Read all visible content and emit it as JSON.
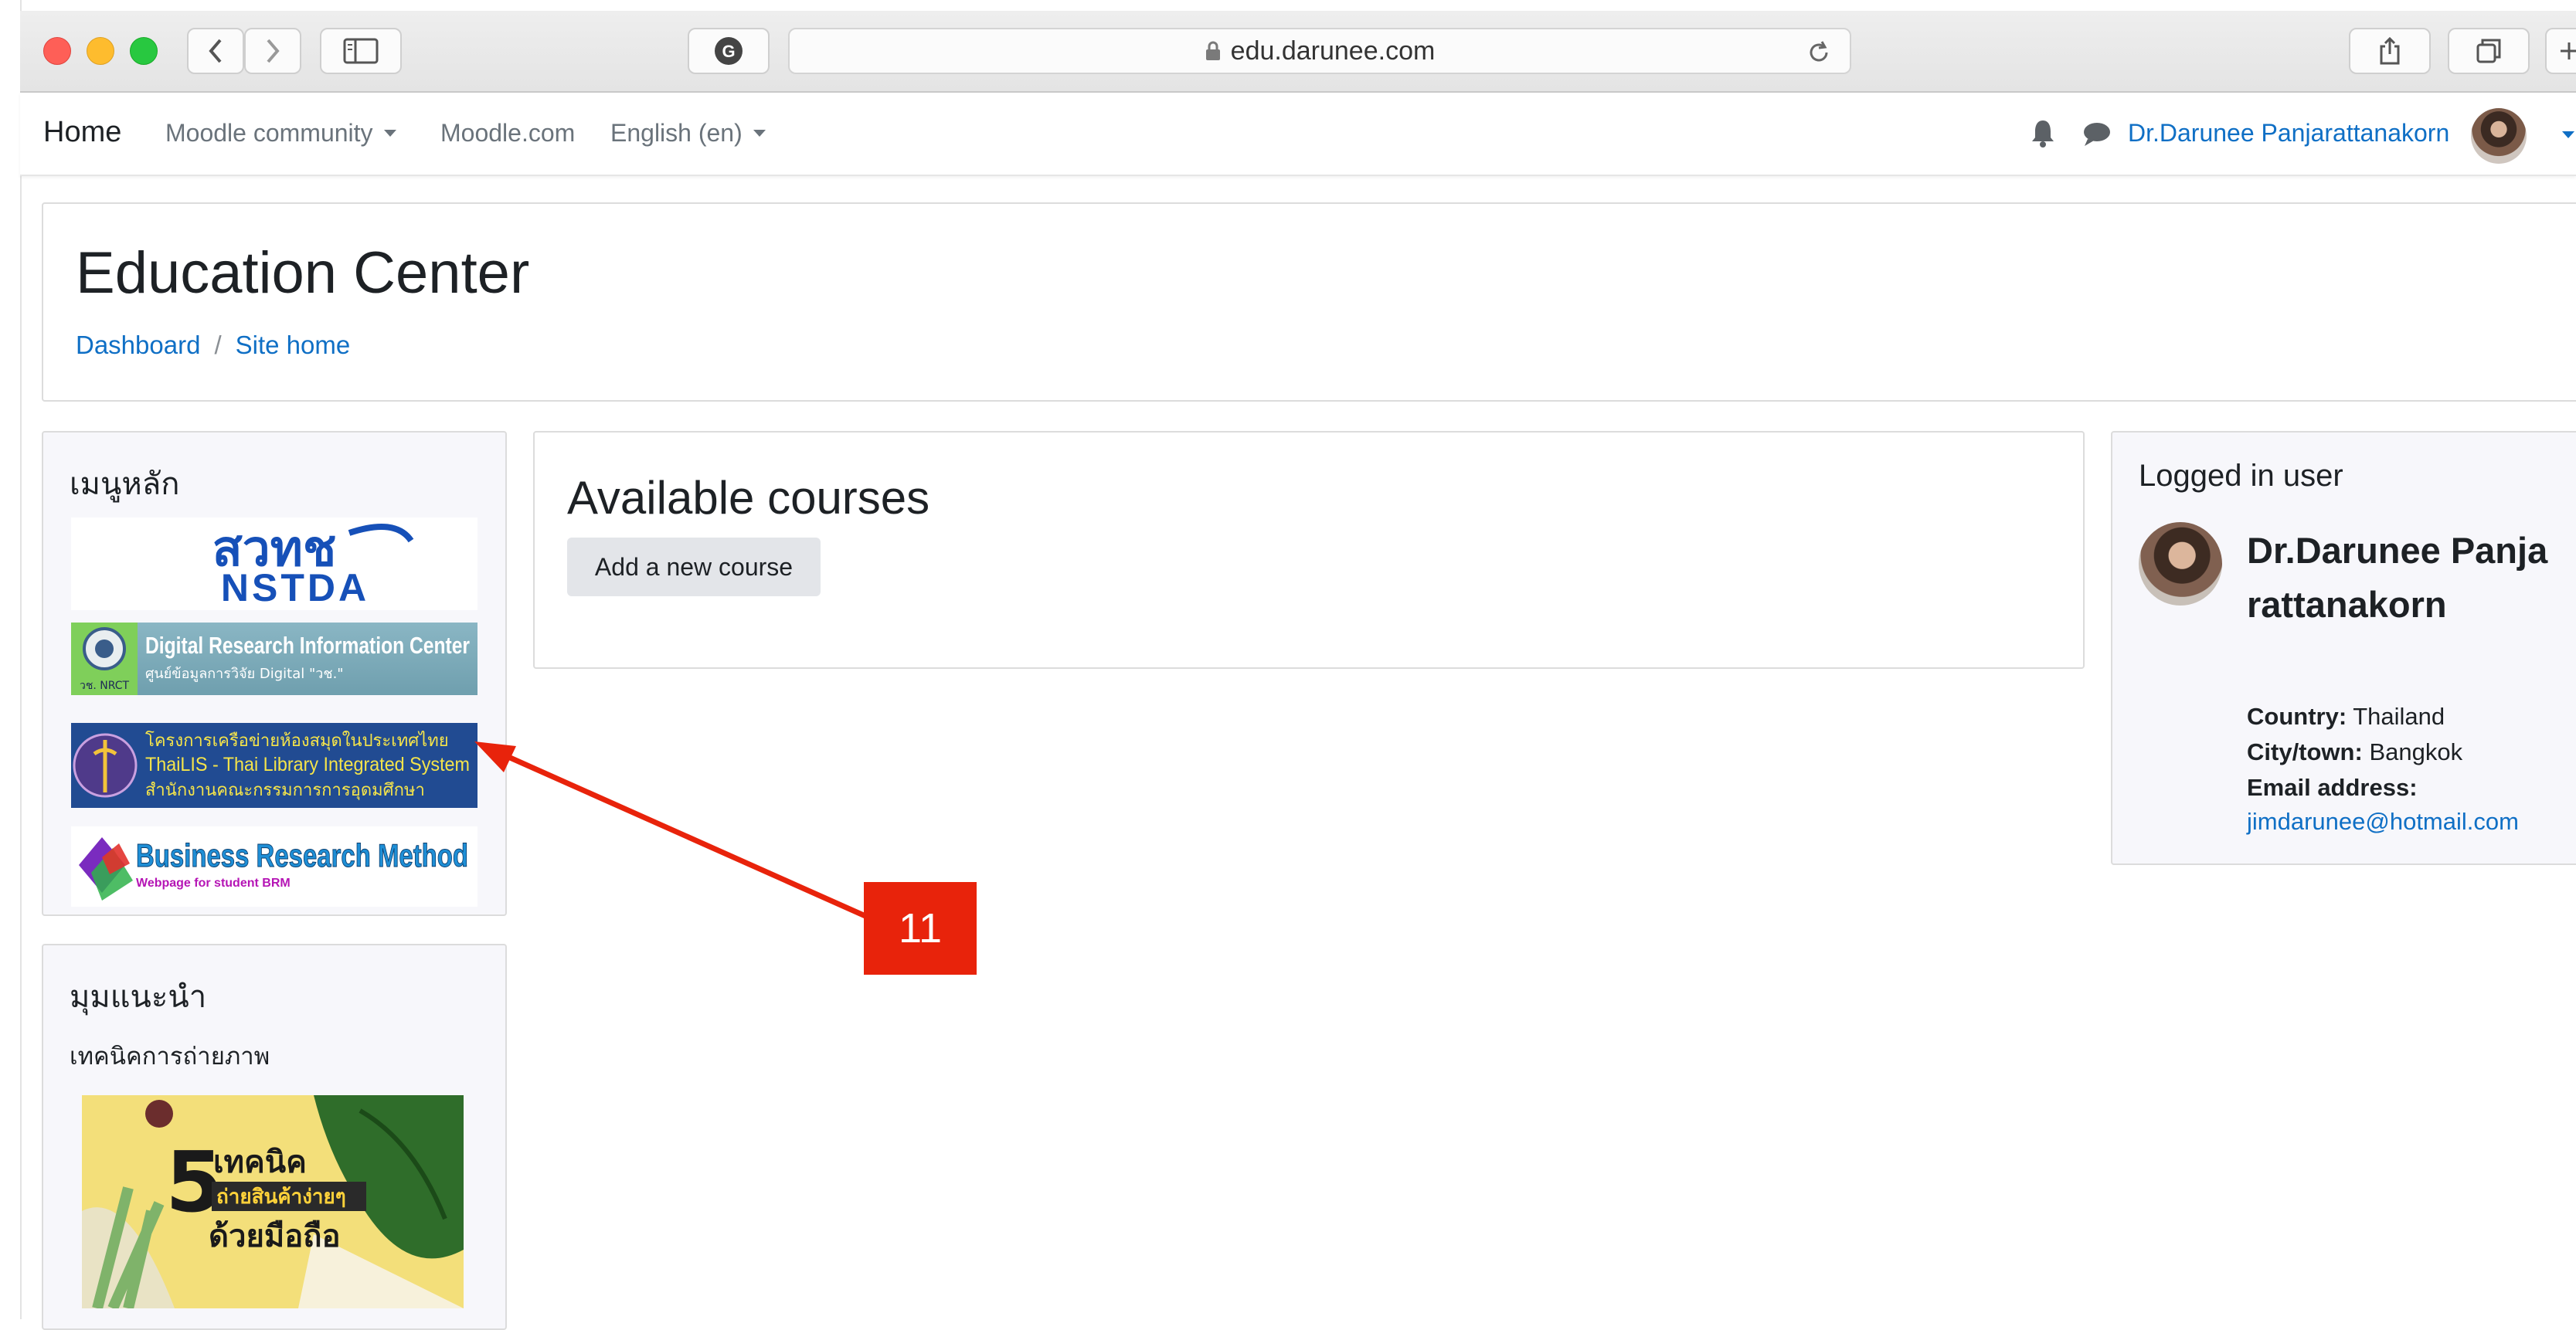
{
  "browser": {
    "url": "edu.darunee.com"
  },
  "navbar": {
    "home": "Home",
    "menu": [
      {
        "label": "Moodle community",
        "dropdown": true
      },
      {
        "label": "Moodle.com",
        "dropdown": false
      },
      {
        "label": "English (en)",
        "dropdown": true
      }
    ],
    "user_name": "Dr.Darunee Panjarattanakorn",
    "icons": [
      "bell-icon",
      "chat-icon"
    ]
  },
  "header": {
    "title": "Education Center",
    "breadcrumb": [
      "Dashboard",
      "Site home"
    ],
    "separator": "/"
  },
  "main_menu_block": {
    "title": "เมนูหลัก",
    "logos": [
      {
        "name": "nstda-logo",
        "text_line1": "สวทช",
        "text_line2": "NSTDA"
      },
      {
        "name": "dric-logo",
        "text_line1": "Digital Research Information Center",
        "text_line2": "ศูนย์ข้อมูลการวิจัย Digital \"วช.\"",
        "badge": "วช. NRCT"
      },
      {
        "name": "thailis-logo",
        "text_line1": "โครงการเครือข่ายห้องสมุดในประเทศไทย",
        "text_line2": "ThaiLIS - Thai Library Integrated System",
        "text_line3": "สำนักงานคณะกรรมการการอุดมศึกษา"
      },
      {
        "name": "business-research-logo",
        "text_line1": "Business Research Method",
        "text_line2": "Webpage for student BRM"
      }
    ]
  },
  "recommend_block": {
    "title": "มุมแนะนำ",
    "subtitle": "เทคนิคการถ่ายภาพ",
    "banner": {
      "big_number": "5",
      "line1": "เทคนิค",
      "line2": "ถ่ายสินค้าง่ายๆ",
      "line3": "ด้วยมือถือ"
    }
  },
  "courses": {
    "title": "Available courses",
    "add_button": "Add a new course"
  },
  "logged_in_block": {
    "title": "Logged in user",
    "name": "Dr.Darunee Panjarattanakorn",
    "country_label": "Country:",
    "country": "Thailand",
    "city_label": "City/town:",
    "city": "Bangkok",
    "email_label": "Email address:",
    "email": "jimdarunee@hotmail.com"
  },
  "annotation": {
    "number": "11",
    "color": "#e8230b"
  }
}
